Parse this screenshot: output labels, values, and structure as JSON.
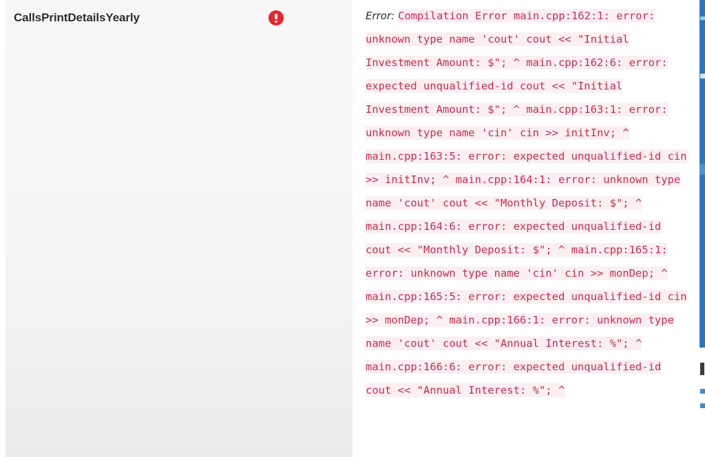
{
  "panel": {
    "title": "CallsPrintDetailsYearly",
    "status_icon": "error-exclamation-circle",
    "status_color": "#e8272c"
  },
  "log": {
    "label": "Error:",
    "text_color": "#c32e51",
    "highlight_color": "#fbeff2",
    "message": "Compilation Error main.cpp:162:1: error: unknown type name 'cout' cout << \"Initial Investment Amount: $\"; ^ main.cpp:162:6: error: expected unqualified-id cout << \"Initial Investment Amount: $\"; ^ main.cpp:163:1: error: unknown type name 'cin' cin >> initInv; ^ main.cpp:163:5: error: expected unqualified-id cin >> initInv; ^ main.cpp:164:1: error: unknown type name 'cout' cout << \"Monthly Deposit: $\"; ^ main.cpp:164:6: error: expected unqualified-id cout << \"Monthly Deposit: $\"; ^ main.cpp:165:1: error: unknown type name 'cin' cin >> monDep; ^ main.cpp:165:5: error: expected unqualified-id cin >> monDep; ^ main.cpp:166:1: error: unknown type name 'cout' cout << \"Annual Interest: %\"; ^ main.cpp:166:6: error: expected unqualified-id cout << \"Annual Interest: %\"; ^"
  },
  "right_sliver": {
    "accent_color": "#2b79bd"
  }
}
